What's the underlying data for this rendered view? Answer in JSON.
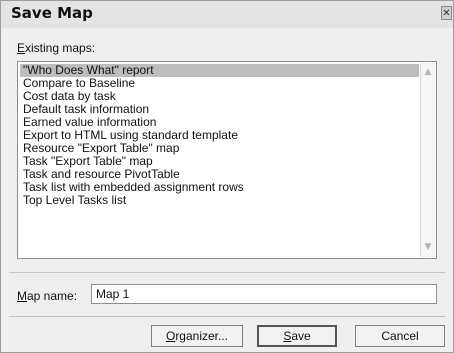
{
  "dialog": {
    "title": "Save Map",
    "close_glyph": "✕"
  },
  "existing_maps": {
    "label_accel": "E",
    "label_rest": "xisting maps:",
    "items": [
      "\"Who Does What\" report",
      "Compare to Baseline",
      "Cost data by task",
      "Default task information",
      "Earned value information",
      "Export to HTML using standard template",
      "Resource \"Export Table\" map",
      "Task \"Export Table\" map",
      "Task and resource PivotTable",
      "Task list with embedded assignment rows",
      "Top Level Tasks list"
    ],
    "selected_index": 0
  },
  "map_name": {
    "label_accel": "M",
    "label_rest": "ap name:",
    "value": "Map 1"
  },
  "buttons": {
    "organizer_accel": "O",
    "organizer_rest": "rganizer...",
    "save_accel": "S",
    "save_rest": "ave",
    "cancel": "Cancel"
  },
  "icons": {
    "scroll_up": "chevron-up-icon",
    "scroll_down": "chevron-down-icon",
    "close": "close-icon"
  }
}
